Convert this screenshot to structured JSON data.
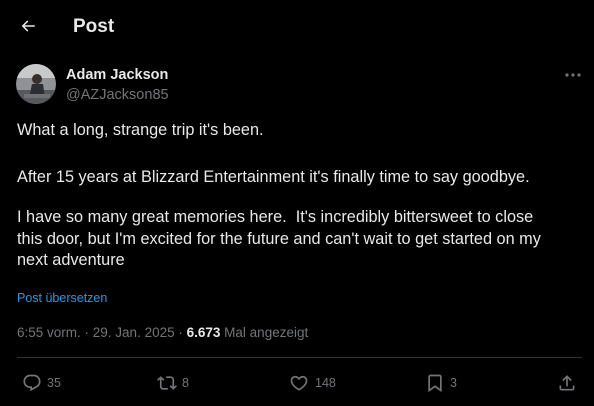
{
  "header": {
    "title": "Post"
  },
  "author": {
    "name": "Adam Jackson",
    "handle": "@AZJackson85"
  },
  "post": {
    "paragraphs": [
      "What a long, strange trip it's been.",
      "After 15 years at Blizzard Entertainment it's finally time to say goodbye.",
      "I have so many great memories here.  It's incredibly bittersweet to close\nthis door, but I'm excited for the future and can't wait to get started on my\nnext adventure"
    ],
    "translate_label": "Post übersetzen"
  },
  "meta": {
    "time": "6:55 vorm.",
    "separator": " · ",
    "date": "29. Jan. 2025",
    "views": "6.673",
    "views_label": "Mal angezeigt"
  },
  "actions": {
    "replies": "35",
    "reposts": "8",
    "likes": "148",
    "bookmarks": "3"
  },
  "colors": {
    "background": "#000000",
    "text_primary": "#e7e9ea",
    "text_secondary": "#71767b",
    "link": "#1d9bf0",
    "divider": "#2f3336"
  },
  "icons": {
    "back": "arrow-left-icon",
    "more": "more-dots-icon",
    "reply": "speech-bubble-icon",
    "repost": "repost-arrows-icon",
    "like": "heart-icon",
    "bookmark": "bookmark-icon",
    "share": "share-upload-icon"
  }
}
